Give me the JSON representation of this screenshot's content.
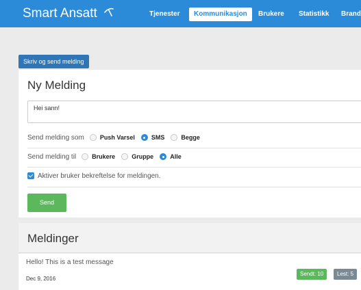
{
  "app": {
    "brand": "Smart Ansatt"
  },
  "nav": {
    "items": [
      {
        "label": "Tjenester",
        "active": false
      },
      {
        "label": "Kommunikasjon",
        "active": true
      },
      {
        "label": "Brukere",
        "active": false
      },
      {
        "label": "Statistikk",
        "active": false
      },
      {
        "label": "Brandi",
        "active": false
      }
    ]
  },
  "compose_tab": {
    "label": "Skriv og send melding"
  },
  "compose": {
    "title": "Ny Melding",
    "message_value": "Hei sann!",
    "send_as": {
      "label": "Send melding som",
      "options": [
        {
          "label": "Push Varsel",
          "checked": false
        },
        {
          "label": "SMS",
          "checked": true
        },
        {
          "label": "Begge",
          "checked": false
        }
      ]
    },
    "send_to": {
      "label": "Send melding til",
      "options": [
        {
          "label": "Brukere",
          "checked": false
        },
        {
          "label": "Gruppe",
          "checked": false
        },
        {
          "label": "Alle",
          "checked": true
        }
      ]
    },
    "confirm": {
      "label": "Aktiver bruker bekreftelse for meldingen.",
      "checked": true
    },
    "send_label": "Send"
  },
  "messages": {
    "title": "Meldinger",
    "items": [
      {
        "text": "Hello! This is a test message",
        "date": "Dec 9, 2016",
        "sent": "Sendt: 10",
        "read": "Lest: 5"
      }
    ]
  },
  "colors": {
    "primary": "#2b8bd9",
    "success": "#5cb85c",
    "muted": "#7a8a93"
  }
}
